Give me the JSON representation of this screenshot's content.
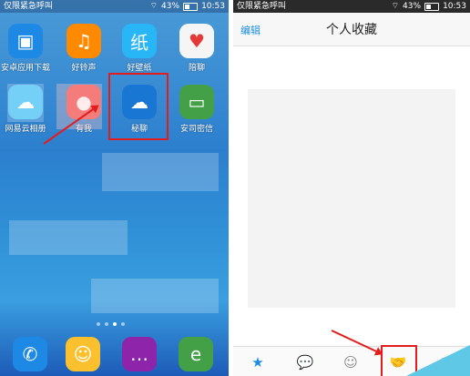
{
  "left_screen": {
    "status": {
      "carrier": "仅限紧急呼叫",
      "battery": "43%",
      "time": "10:53"
    },
    "apps_row1": [
      {
        "label": "安卓应用下载",
        "icon": "shopping-bag-icon",
        "color": "#1e88e5"
      },
      {
        "label": "好铃声",
        "icon": "music-note-icon",
        "color": "#ff8a00"
      },
      {
        "label": "好壁纸",
        "icon": "wallpaper-icon",
        "color": "#29b6f6"
      },
      {
        "label": "陪聊",
        "icon": "heart-icon",
        "color": "#f5f5f5"
      }
    ],
    "apps_row2": [
      {
        "label": "网易云相册",
        "icon": "cloud-album-icon",
        "color": "#4fc3f7"
      },
      {
        "label": "有我",
        "icon": "youwo-icon",
        "color": "#ef5350"
      },
      {
        "label": "秘聊",
        "icon": "cloud-chat-icon",
        "color": "#1976d2"
      },
      {
        "label": "安司密信",
        "icon": "message-icon",
        "color": "#43a047"
      }
    ],
    "dock": [
      {
        "icon": "phone-icon",
        "color": "#1e88e5"
      },
      {
        "icon": "contacts-icon",
        "color": "#fbc02d"
      },
      {
        "icon": "chat-bubble-icon",
        "color": "#8e24aa"
      },
      {
        "icon": "browser-icon",
        "color": "#43a047"
      }
    ],
    "page_dots": 4,
    "active_dot": 3
  },
  "right_screen": {
    "status": {
      "carrier": "仅限紧急呼叫",
      "battery": "43%",
      "time": "10:53"
    },
    "header": {
      "edit_label": "编辑",
      "title": "个人收藏"
    },
    "tabs": [
      {
        "icon": "star-icon",
        "color": "#1a8fe0"
      },
      {
        "icon": "chat-icon",
        "color": "#888888"
      },
      {
        "icon": "contacts-icon",
        "color": "#888888"
      },
      {
        "icon": "handshake-icon",
        "color": "#888888"
      },
      {
        "icon": "settings-icon",
        "color": "#888888"
      }
    ]
  },
  "colors": {
    "highlight": "#e31c1c",
    "accent": "#1a8fe0"
  }
}
